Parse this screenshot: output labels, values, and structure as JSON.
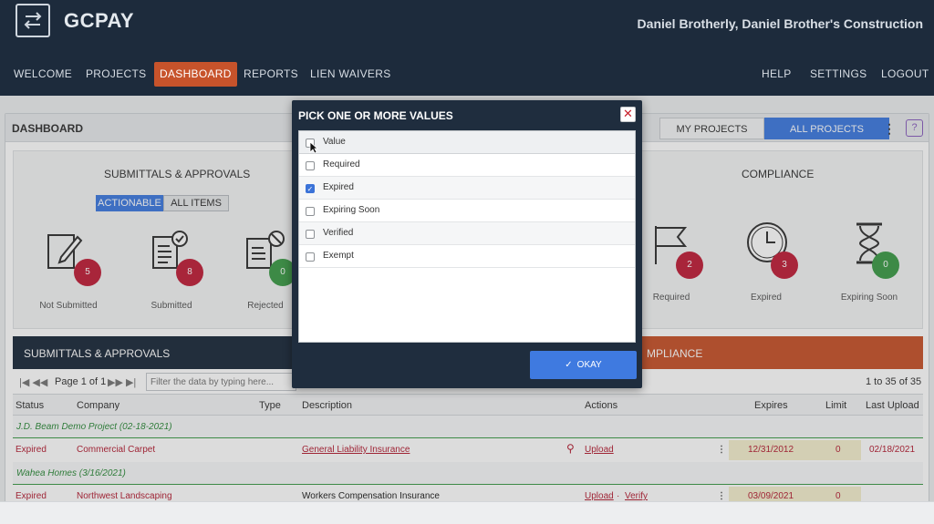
{
  "app": {
    "name": "GCPAY",
    "user": "Daniel Brotherly, Daniel Brother's Construction"
  },
  "nav": {
    "left": [
      "WELCOME",
      "PROJECTS",
      "DASHBOARD",
      "REPORTS",
      "LIEN WAIVERS"
    ],
    "right": [
      "HELP",
      "SETTINGS",
      "LOGOUT"
    ],
    "active": "DASHBOARD"
  },
  "dashboard": {
    "title": "DASHBOARD",
    "toggle": {
      "my_projects": "MY PROJECTS",
      "all_projects": "ALL PROJECTS"
    },
    "help_icon": "?",
    "submittals": {
      "title": "SUBMITTALS & APPROVALS",
      "filters": [
        "ACTIONABLE",
        "ALL ITEMS"
      ],
      "tiles": [
        {
          "label": "Not Submitted",
          "count": "5",
          "icon": "pencil-document-icon",
          "color": "#c0203a"
        },
        {
          "label": "Submitted",
          "count": "8",
          "icon": "checked-document-icon",
          "color": "#c0203a"
        },
        {
          "label": "Rejected",
          "count": "0",
          "icon": "rejected-document-icon",
          "color": "#3d9b48"
        }
      ]
    },
    "compliance": {
      "title": "COMPLIANCE",
      "tiles": [
        {
          "label": "Required",
          "count": "2",
          "icon": "flag-icon",
          "color": "#c0203a"
        },
        {
          "label": "Expired",
          "count": "3",
          "icon": "clock-icon",
          "color": "#c0203a"
        },
        {
          "label": "Expiring Soon",
          "count": "0",
          "icon": "hourglass-icon",
          "color": "#3d9b48"
        }
      ]
    }
  },
  "grid": {
    "title": "SUBMITTALS & APPROVALS",
    "title_right": "MPLIANCE",
    "page_text": "Page 1 of 1",
    "pager_icons": "|◀ ◀◀",
    "pager_icons_right": "▶▶ ▶|",
    "filter_placeholder": "Filter the data by typing here...",
    "range": "1 to 35 of 35",
    "columns": [
      "Status",
      "Company",
      "Type",
      "Description",
      "Actions",
      "Expires",
      "Limit",
      "Last Upload"
    ],
    "groups": [
      {
        "name": "J.D. Beam Demo Project (02-18-2021)",
        "rows": [
          {
            "status": "Expired",
            "company": "Commercial Carpet",
            "description": "General Liability Insurance",
            "action1": "Upload",
            "action2": "",
            "expires": "12/31/2012",
            "limit": "0",
            "last_upload": "02/18/2021"
          }
        ]
      },
      {
        "name": "Wahea Homes (3/16/2021)",
        "rows": [
          {
            "status": "Expired",
            "company": "Northwest Landscaping",
            "description": "Workers Compensation Insurance",
            "action1": "Upload",
            "action2": "Verify",
            "expires": "03/09/2021",
            "limit": "0",
            "last_upload": ""
          }
        ]
      }
    ]
  },
  "modal": {
    "title": "PICK ONE OR MORE VALUES",
    "close": "✕",
    "header": "Value",
    "options": [
      {
        "label": "Required",
        "checked": false
      },
      {
        "label": "Expired",
        "checked": true
      },
      {
        "label": "Expiring Soon",
        "checked": false
      },
      {
        "label": "Verified",
        "checked": false
      },
      {
        "label": "Exempt",
        "checked": false
      }
    ],
    "okay": "OKAY",
    "check_mark": "✓"
  }
}
